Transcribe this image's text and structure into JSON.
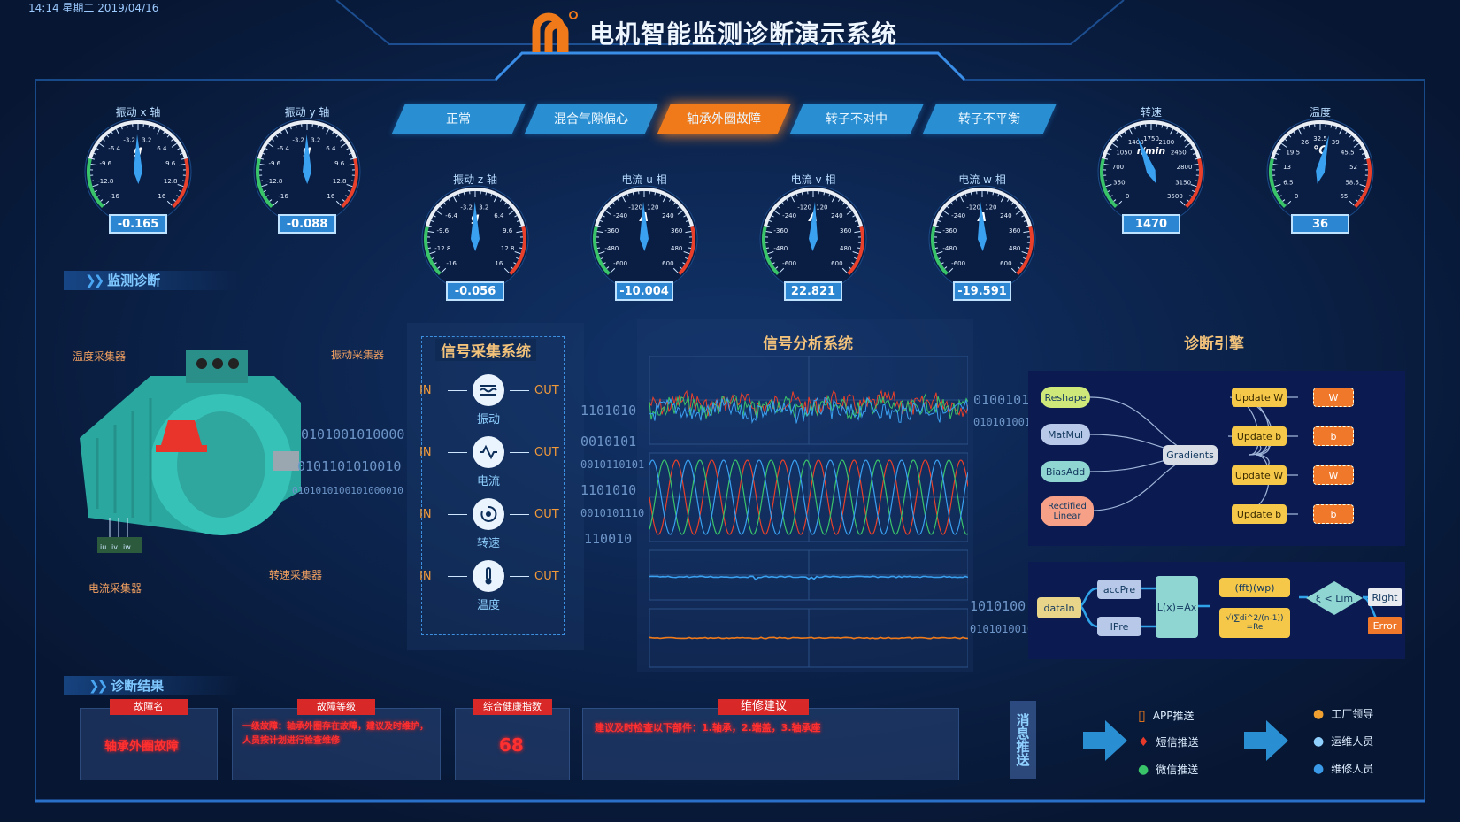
{
  "header": {
    "datetime": "14:14 星期二 2019/04/16",
    "title": "电机智能监测诊断演示系统"
  },
  "tabs": [
    {
      "label": "正常",
      "active": false
    },
    {
      "label": "混合气隙偏心",
      "active": false
    },
    {
      "label": "轴承外圈故障",
      "active": true
    },
    {
      "label": "转子不对中",
      "active": false
    },
    {
      "label": "转子不平衡",
      "active": false
    }
  ],
  "gauges": [
    {
      "name": "vib-x",
      "title": "振动 x 轴",
      "unit": "g",
      "ticks": [
        "-16",
        "-12.8",
        "-9.6",
        "-6.4",
        "-3.2",
        "3.2",
        "6.4",
        "9.6",
        "12.8",
        "16"
      ],
      "value": "-0.165",
      "needle": -0.01
    },
    {
      "name": "vib-y",
      "title": "振动 y 轴",
      "unit": "g",
      "ticks": [
        "-16",
        "-12.8",
        "-9.6",
        "-6.4",
        "-3.2",
        "3.2",
        "6.4",
        "9.6",
        "12.8",
        "16"
      ],
      "value": "-0.088",
      "needle": -0.005
    },
    {
      "name": "vib-z",
      "title": "振动 z 轴",
      "unit": "g",
      "ticks": [
        "-16",
        "-12.8",
        "-9.6",
        "-6.4",
        "-3.2",
        "3.2",
        "6.4",
        "9.6",
        "12.8",
        "16"
      ],
      "value": "-0.056",
      "needle": -0.003
    },
    {
      "name": "cur-u",
      "title": "电流 u 相",
      "unit": "A",
      "ticks": [
        "-600",
        "-480",
        "-360",
        "-240",
        "-120",
        "120",
        "240",
        "360",
        "480",
        "600"
      ],
      "value": "-10.004",
      "needle": -0.01
    },
    {
      "name": "cur-v",
      "title": "电流 v 相",
      "unit": "A",
      "ticks": [
        "-600",
        "-480",
        "-360",
        "-240",
        "-120",
        "120",
        "240",
        "360",
        "480",
        "600"
      ],
      "value": "22.821",
      "needle": 0.02
    },
    {
      "name": "cur-w",
      "title": "电流 w 相",
      "unit": "A",
      "ticks": [
        "-600",
        "-480",
        "-360",
        "-240",
        "-120",
        "120",
        "240",
        "360",
        "480",
        "600"
      ],
      "value": "-19.591",
      "needle": -0.02
    },
    {
      "name": "speed",
      "title": "转速",
      "unit": "r/min",
      "ticks": [
        "0",
        "350",
        "700",
        "1050",
        "1400",
        "1750",
        "2100",
        "2450",
        "2800",
        "3150",
        "3500"
      ],
      "value": "1470",
      "needle": -0.16
    },
    {
      "name": "temp",
      "title": "温度",
      "unit": "℃",
      "ticks": [
        "0",
        "6.5",
        "13",
        "19.5",
        "26",
        "32.5",
        "39",
        "45.5",
        "52",
        "58.5",
        "65"
      ],
      "value": "36",
      "needle": 0.1
    }
  ],
  "monitor": {
    "section_title": "监测诊断",
    "labels": {
      "temp_collector": "温度采集器",
      "vib_collector": "振动采集器",
      "speed_collector": "转速采集器",
      "current_collector": "电流采集器"
    },
    "phase_labels": [
      "iu",
      "iv",
      "iw"
    ],
    "binary_left": [
      "0101001010000",
      "0101101010010",
      "0101010100101000010"
    ]
  },
  "acquisition": {
    "title": "信号采集系统",
    "in_label": "IN",
    "out_label": "OUT",
    "signals": [
      {
        "label": "振动",
        "icon": "vibration-icon"
      },
      {
        "label": "电流",
        "icon": "sine-wave-icon"
      },
      {
        "label": "转速",
        "icon": "rotation-icon"
      },
      {
        "label": "温度",
        "icon": "thermometer-icon"
      }
    ],
    "binary_mid": [
      "1101010",
      "0010101",
      "0010110101",
      "1101010",
      "0010101110",
      "110010"
    ]
  },
  "analysis": {
    "title": "信号分析系统",
    "binary_right": [
      "0100101",
      "0101010010",
      "1010100",
      "0101010010"
    ]
  },
  "engine": {
    "title": "诊断引擎",
    "graph1": {
      "nodes": [
        "Reshape",
        "MatMul",
        "BiasAdd",
        "Rectified Linear",
        "Gradients"
      ],
      "updates": [
        "Update W",
        "Update b",
        "Update W",
        "Update b"
      ],
      "outputs": [
        "W",
        "b",
        "W",
        "b"
      ]
    },
    "graph2": {
      "nodes": [
        "dataIn",
        "accPre",
        "IPre",
        "L(x)=Ax",
        "(fft)(wp)",
        "√(∑di^2/(n-1)) =Re",
        "ξ < Lim",
        "Right",
        "Error"
      ]
    }
  },
  "results": {
    "section_title": "诊断结果",
    "fault_name": {
      "tag": "故障名",
      "text": "轴承外圈故障"
    },
    "fault_level": {
      "tag": "故障等级",
      "text": "一级故障：轴承外圈存在故障，建议及时维护，人员按计划进行检查维修"
    },
    "health": {
      "tag": "综合健康指数",
      "text": "68"
    },
    "advice": {
      "tag": "维修建议",
      "text": "建议及时检查以下部件：1.轴承，2.端盖，3.轴承座"
    }
  },
  "push": {
    "label": "消息推送",
    "channels": [
      "APP推送",
      "短信推送",
      "微信推送"
    ],
    "recipients": [
      "工厂领导",
      "运维人员",
      "维修人员"
    ]
  }
}
